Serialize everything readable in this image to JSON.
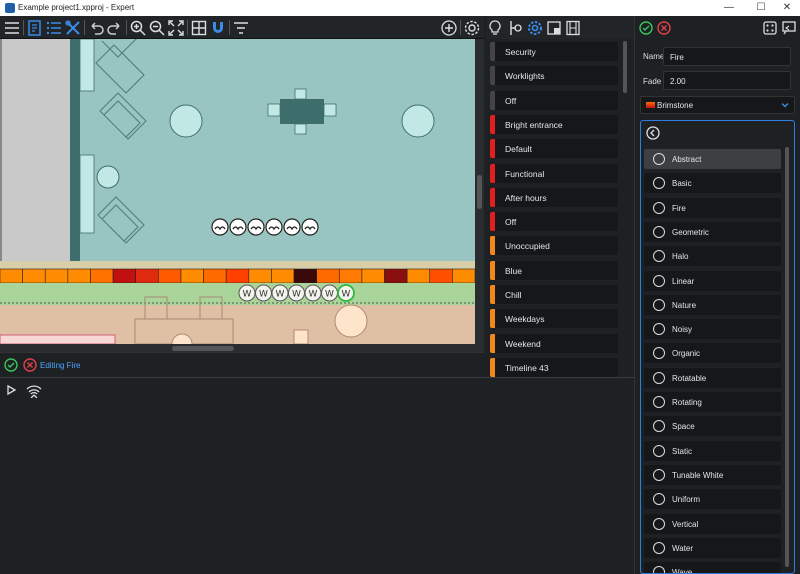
{
  "window": {
    "title": "Example project1.xpproj - Expert",
    "minimize": "—",
    "maximize": "☐",
    "close": "✕"
  },
  "toolbar": {
    "icons": [
      "menu-icon",
      "floorplan-icon",
      "list-icon",
      "tools-icon",
      "undo-icon",
      "redo-icon",
      "zoom-in-icon",
      "zoom-out-icon",
      "fit-icon",
      "grid-icon",
      "magnet-icon",
      "filter-icon",
      "add-icon",
      "settings-icon"
    ]
  },
  "floorplan": {
    "fixture_group_top": [
      "dim",
      "dim",
      "dim",
      "dim",
      "dim",
      "dim"
    ],
    "fixture_group_bottom": [
      "W",
      "W",
      "W",
      "W",
      "W",
      "W",
      "W"
    ],
    "led_strip": [
      "#ff8c00",
      "#ff8c00",
      "#ff8c00",
      "#ff8c00",
      "#ff7200",
      "#c01010",
      "#e02a10",
      "#ff5a00",
      "#ff8c00",
      "#ff6a00",
      "#ff4000",
      "#ff8c00",
      "#ff8c00",
      "#3a0a0a",
      "#ff6a00",
      "#ff7a00",
      "#ff8c00",
      "#8a1010",
      "#ff8c00",
      "#ff5000",
      "#ff8c00"
    ]
  },
  "editbar": {
    "label": "Editing Fire"
  },
  "scenes": {
    "header_icons": [
      "bulb-icon",
      "fixture-icon",
      "gear-icon",
      "scene-icon",
      "film-icon"
    ],
    "items": [
      {
        "label": "Security",
        "color": "#444444"
      },
      {
        "label": "Worklights",
        "color": "#444444"
      },
      {
        "label": "Off",
        "color": "#444444"
      },
      {
        "label": "Bright entrance",
        "color": "#e02020"
      },
      {
        "label": "Default",
        "color": "#e02020"
      },
      {
        "label": "Functional",
        "color": "#e02020"
      },
      {
        "label": "After hours",
        "color": "#e02020"
      },
      {
        "label": "Off",
        "color": "#e02020"
      },
      {
        "label": "Unoccupied",
        "color": "#f08820"
      },
      {
        "label": "Blue",
        "color": "#f08820"
      },
      {
        "label": "Chill",
        "color": "#f08820"
      },
      {
        "label": "Weekdays",
        "color": "#f08820"
      },
      {
        "label": "Weekend",
        "color": "#f08820"
      },
      {
        "label": "Timeline 43",
        "color": "#f08820"
      }
    ]
  },
  "properties": {
    "name_label": "Name",
    "name_value": "Fire",
    "fade_label": "Fade",
    "fade_value": "2.00",
    "effect_value": "Brimstone",
    "categories": [
      "Abstract",
      "Basic",
      "Fire",
      "Geometric",
      "Halo",
      "Linear",
      "Nature",
      "Noisy",
      "Organic",
      "Rotatable",
      "Rotating",
      "Space",
      "Static",
      "Tunable White",
      "Uniform",
      "Vertical",
      "Water",
      "Wave"
    ],
    "selected_category": "Abstract"
  }
}
